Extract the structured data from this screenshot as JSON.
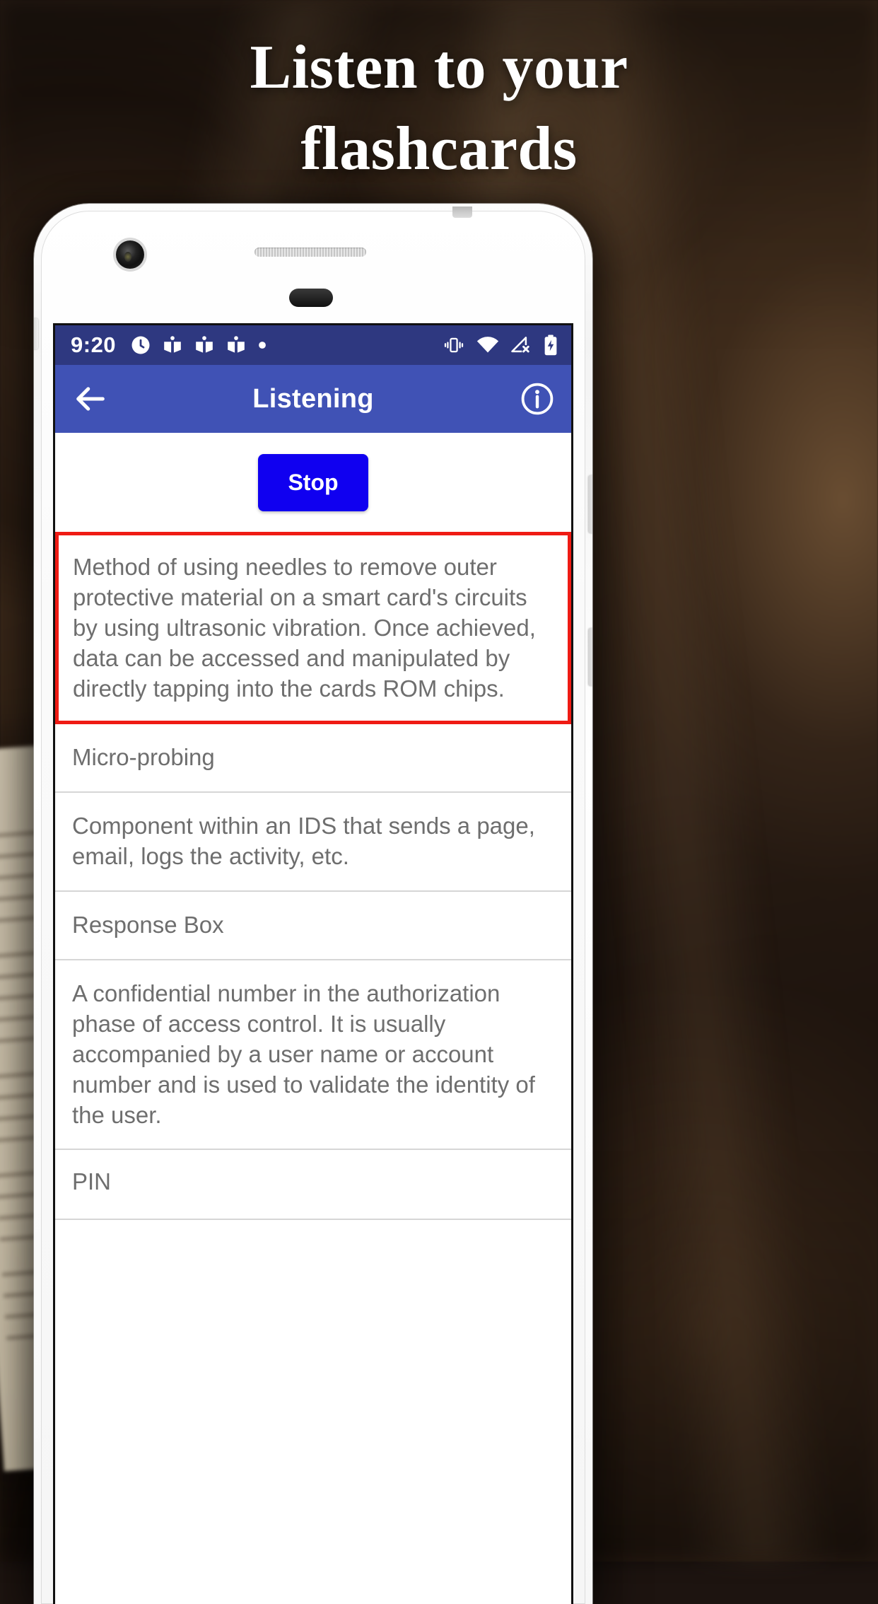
{
  "promo": {
    "headline_line1": "Listen to your",
    "headline_line2": "flashcards"
  },
  "colors": {
    "status_bar": "#2e3880",
    "app_bar": "#4052b5",
    "stop_button": "#1000f0",
    "active_card_border": "#ef1b14",
    "card_text": "#6e6e6e",
    "divider": "#d6d6d6"
  },
  "phone": {
    "status_bar": {
      "time": "9:20",
      "left_icons": [
        "notification-clock-icon",
        "flashcard-book-icon",
        "flashcard-book-icon",
        "flashcard-book-icon",
        "notification-dot-icon"
      ],
      "right_icons": [
        "vibrate-icon",
        "wifi-icon",
        "no-signal-icon",
        "battery-charging-icon"
      ]
    },
    "app_bar": {
      "back_icon": "back-arrow-icon",
      "title": "Listening",
      "info_icon": "info-icon"
    },
    "controls": {
      "stop_label": "Stop"
    },
    "cards": [
      {
        "text": "Method of using needles to remove outer protective material on a smart card's circuits by using ultrasonic vibration. Once achieved, data can be accessed and manipulated by directly tapping into the cards ROM chips.",
        "active": true
      },
      {
        "text": "Micro-probing",
        "active": false
      },
      {
        "text": "Component within an IDS that sends a page, email, logs the activity, etc.",
        "active": false
      },
      {
        "text": "Response Box",
        "active": false
      },
      {
        "text": "A confidential number in the authorization phase of access control. It is usually accompanied by a user name or account number and is used to validate the identity of the user.",
        "active": false
      },
      {
        "text": "PIN",
        "active": false
      }
    ]
  }
}
